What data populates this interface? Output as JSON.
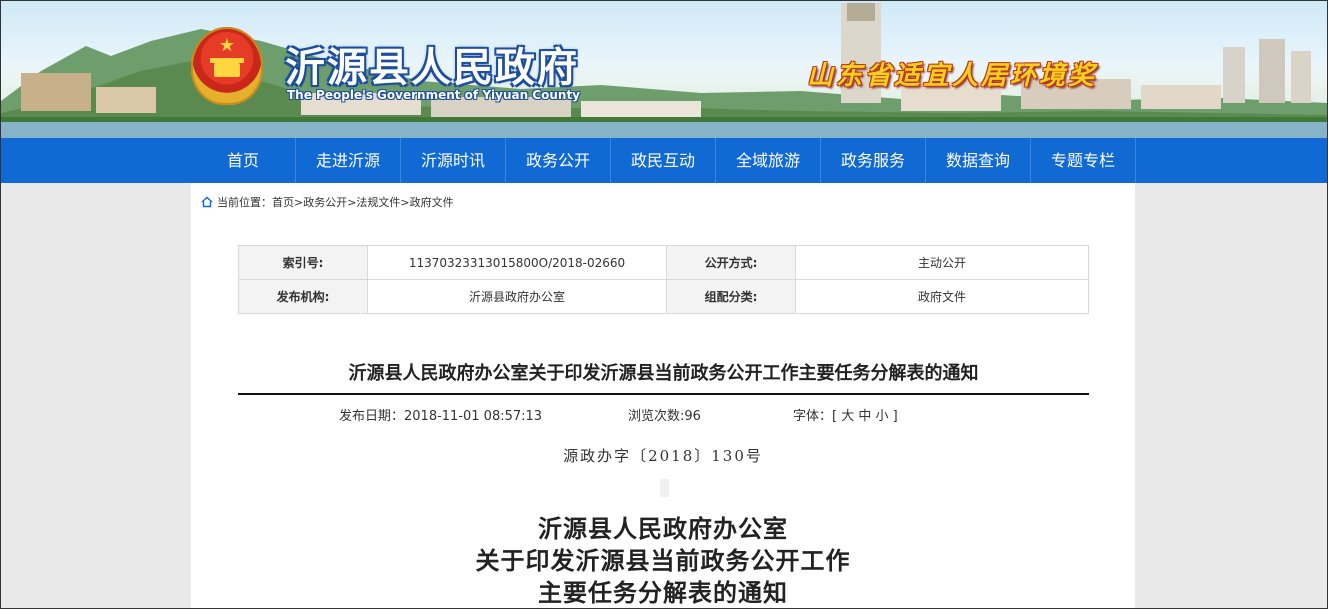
{
  "header": {
    "site_title": "沂源县人民政府",
    "site_subtitle": "The People's Government of Yiyuan County",
    "award": "山东省适宜人居环境奖"
  },
  "nav": {
    "items": [
      "首页",
      "走进沂源",
      "沂源时讯",
      "政务公开",
      "政民互动",
      "全域旅游",
      "政务服务",
      "数据查询",
      "专题专栏"
    ]
  },
  "breadcrumb": {
    "icon": "home-icon",
    "text": "当前位置：首页>政务公开>法规文件>政府文件"
  },
  "meta_table": {
    "rows": [
      {
        "label1": "索引号:",
        "value1": "11370323313015800O/2018-02660",
        "label2": "公开方式:",
        "value2": "主动公开"
      },
      {
        "label1": "发布机构:",
        "value1": "沂源县政府办公室",
        "label2": "组配分类:",
        "value2": "政府文件"
      }
    ]
  },
  "document": {
    "title": "沂源县人民政府办公室关于印发沂源县当前政务公开工作主要任务分解表的通知",
    "publish_date": "发布日期：2018-11-01 08:57:13",
    "views": "浏览次数:96",
    "font_size": "字体：[ 大 中 小 ]",
    "doc_number": "源政办字〔2018〕130号",
    "body_title_lines": [
      "沂源县人民政府办公室",
      "关于印发沂源县当前政务公开工作",
      "主要任务分解表的通知"
    ]
  },
  "colors": {
    "nav_bg": "#1169d4",
    "title_outline": "#1d4f9e",
    "award_text": "#f3d21d",
    "page_bg": "#e9e9e9"
  }
}
